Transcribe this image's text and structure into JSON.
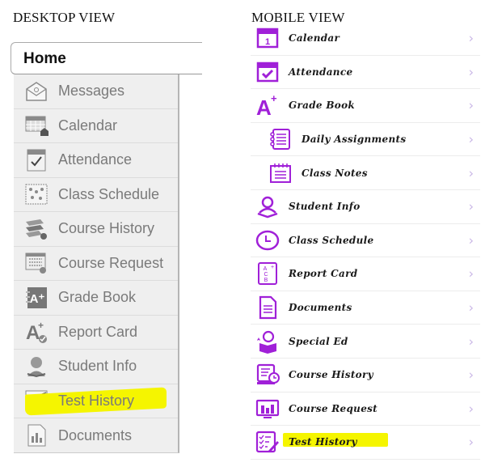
{
  "headings": {
    "desktop": "DESKTOP VIEW",
    "mobile": "MOBILE VIEW"
  },
  "desktop": {
    "home_tab": "Home",
    "items": [
      {
        "label": "Messages",
        "icon": "envelope-icon"
      },
      {
        "label": "Calendar",
        "icon": "calendar-icon"
      },
      {
        "label": "Attendance",
        "icon": "attendance-icon"
      },
      {
        "label": "Class Schedule",
        "icon": "class-schedule-icon"
      },
      {
        "label": "Course History",
        "icon": "books-icon"
      },
      {
        "label": "Course Request",
        "icon": "course-request-icon"
      },
      {
        "label": "Grade Book",
        "icon": "gradebook-icon"
      },
      {
        "label": "Report Card",
        "icon": "report-card-icon"
      },
      {
        "label": "Student Info",
        "icon": "student-icon"
      },
      {
        "label": "Test History",
        "icon": "test-history-icon",
        "highlighted": true
      },
      {
        "label": "Documents",
        "icon": "documents-icon"
      }
    ]
  },
  "mobile": {
    "chevron": "›",
    "items": [
      {
        "label": "Calendar",
        "icon": "calendar-icon"
      },
      {
        "label": "Attendance",
        "icon": "attendance-icon"
      },
      {
        "label": "Grade Book",
        "icon": "grade-a-plus-icon"
      },
      {
        "label": "Daily Assignments",
        "icon": "notebook-icon",
        "indent": true
      },
      {
        "label": "Class Notes",
        "icon": "notes-icon",
        "indent": true
      },
      {
        "label": "Student Info",
        "icon": "student-icon"
      },
      {
        "label": "Class Schedule",
        "icon": "clock-icon"
      },
      {
        "label": "Report Card",
        "icon": "report-card-icon"
      },
      {
        "label": "Documents",
        "icon": "document-icon"
      },
      {
        "label": "Special Ed",
        "icon": "special-ed-icon"
      },
      {
        "label": "Course History",
        "icon": "course-history-icon"
      },
      {
        "label": "Course Request",
        "icon": "course-request-icon"
      },
      {
        "label": "Test History",
        "icon": "test-history-icon",
        "highlighted": true
      }
    ]
  },
  "colors": {
    "mobile_accent": "#a020d8",
    "desktop_icon": "#8a8a8a",
    "highlight": "#f5f500"
  }
}
